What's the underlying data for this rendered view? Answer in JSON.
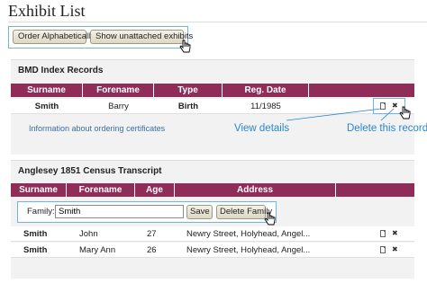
{
  "header": {
    "title": "Exhibit List"
  },
  "toolbar": {
    "order_alphabetically_label": "Order Alphabetically",
    "show_unattached_label": "Show unattached exhibits"
  },
  "bmd": {
    "title": "BMD Index Records",
    "columns": [
      "Surname",
      "Forename",
      "Type",
      "Reg. Date"
    ],
    "rows": [
      {
        "surname": "Smith",
        "forename": "Barry",
        "type": "Birth",
        "reg_date": "11/1985"
      }
    ],
    "info_link": "Information about ordering certificates"
  },
  "census": {
    "title": "Anglesey 1851 Census Transcript",
    "columns": [
      "Surname",
      "Forename",
      "Age",
      "Address"
    ],
    "family_label": "Family:",
    "family_value": "Smith",
    "save_label": "Save",
    "delete_family_label": "Delete Family",
    "rows": [
      {
        "surname": "Smith",
        "forename": "John",
        "age": "27",
        "address": "Newry Street, Holyhead, Angel..."
      },
      {
        "surname": "Smith",
        "forename": "Mary Ann",
        "age": "26",
        "address": "Newry Street, Holyhead, Angel..."
      }
    ]
  },
  "annotations": {
    "view_details": "View details",
    "delete_this_record": "Delete this record"
  },
  "colors": {
    "header_bg": "#8f2c58",
    "annotation_blue": "#2a86d1",
    "highlight_border": "#6fb6e6"
  }
}
